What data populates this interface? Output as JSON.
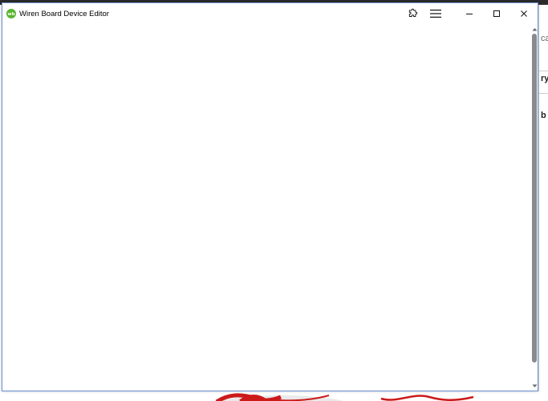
{
  "window": {
    "title": "Wiren Board Device Editor",
    "icon": "wirenboard-logo-icon",
    "accent_color": "#6c8fd1",
    "logo_color": "#5cb531"
  },
  "titlebar": {
    "buttons": [
      {
        "name": "extensions-button",
        "icon": "puzzle-icon"
      },
      {
        "name": "menu-button",
        "icon": "hamburger-icon"
      },
      {
        "name": "minimize-button",
        "icon": "minimize-icon"
      },
      {
        "name": "maximize-button",
        "icon": "maximize-icon"
      },
      {
        "name": "close-button",
        "icon": "close-icon"
      }
    ]
  },
  "content": {
    "scrollbar": {
      "thumb_color": "#8a8a8a"
    }
  },
  "background": {
    "fragments": [
      "ca",
      "ry",
      "b"
    ]
  }
}
